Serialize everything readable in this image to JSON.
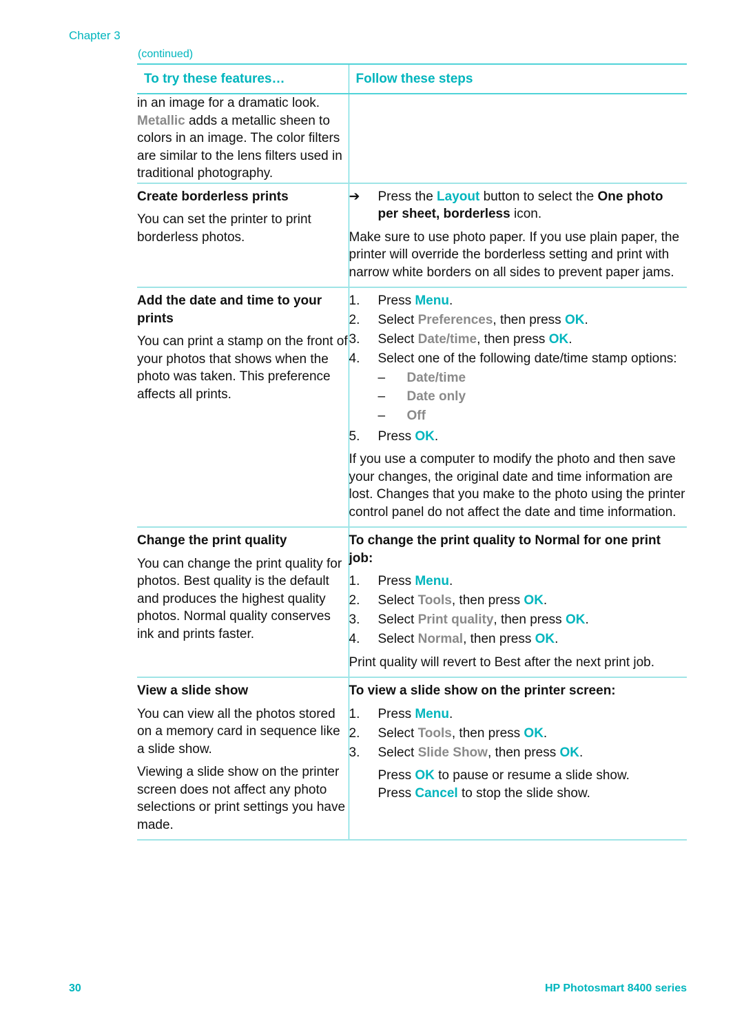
{
  "header": {
    "chapter": "Chapter 3",
    "continued": "(continued)"
  },
  "table": {
    "col1_header": "To try these features…",
    "col2_header": "Follow these steps",
    "rows": {
      "filters": {
        "left_text_1": "in an image for a dramatic look. ",
        "left_metallic": "Metallic",
        "left_text_2": " adds a metallic sheen to colors in an image. The color filters are similar to the lens filters used in traditional photography."
      },
      "borderless": {
        "title": "Create borderless prints",
        "desc": "You can set the printer to print borderless photos.",
        "arrow": "➔",
        "step_pre": "Press the ",
        "step_layout": "Layout",
        "step_mid": " button to select the ",
        "step_bold": "One photo per sheet, borderless",
        "step_post": " icon.",
        "note": "Make sure to use photo paper. If you use plain paper, the printer will override the borderless setting and print with narrow white borders on all sides to prevent paper jams."
      },
      "datetime": {
        "title": "Add the date and time to your prints",
        "desc": "You can print a stamp on the front of your photos that shows when the photo was taken. This preference affects all prints.",
        "steps": [
          {
            "num": "1.",
            "pre": "Press ",
            "hl": "Menu",
            "post": "."
          },
          {
            "num": "2.",
            "pre": "Select ",
            "gray": "Preferences",
            "mid": ", then press ",
            "hl": "OK",
            "post": "."
          },
          {
            "num": "3.",
            "pre": "Select ",
            "gray": "Date/time",
            "mid": ", then press ",
            "hl": "OK",
            "post": "."
          },
          {
            "num": "4.",
            "text": "Select one of the following date/time stamp options:"
          },
          {
            "num": "5.",
            "pre": "Press ",
            "hl": "OK",
            "post": "."
          }
        ],
        "options": [
          {
            "dash": "–",
            "label": "Date/time"
          },
          {
            "dash": "–",
            "label": "Date only"
          },
          {
            "dash": "–",
            "label": "Off"
          }
        ],
        "note": "If you use a computer to modify the photo and then save your changes, the original date and time information are lost. Changes that you make to the photo using the printer control panel do not affect the date and time information."
      },
      "quality": {
        "title": "Change the print quality",
        "desc": "You can change the print quality for photos. Best quality is the default and produces the highest quality photos. Normal quality conserves ink and prints faster.",
        "heading": "To change the print quality to Normal for one print job:",
        "steps": [
          {
            "num": "1.",
            "pre": "Press ",
            "hl": "Menu",
            "post": "."
          },
          {
            "num": "2.",
            "pre": "Select ",
            "gray": "Tools",
            "mid": ", then press ",
            "hl": "OK",
            "post": "."
          },
          {
            "num": "3.",
            "pre": "Select ",
            "gray": "Print quality",
            "mid": ", then press ",
            "hl": "OK",
            "post": "."
          },
          {
            "num": "4.",
            "pre": "Select ",
            "gray": "Normal",
            "mid": ", then press ",
            "hl": "OK",
            "post": "."
          }
        ],
        "note": "Print quality will revert to Best after the next print job."
      },
      "slideshow": {
        "title": "View a slide show",
        "desc_1": "You can view all the photos stored on a memory card in sequence like a slide show.",
        "desc_2": "Viewing a slide show on the printer screen does not affect any photo selections or print settings you have made.",
        "heading": "To view a slide show on the printer screen:",
        "steps": [
          {
            "num": "1.",
            "pre": "Press ",
            "hl": "Menu",
            "post": "."
          },
          {
            "num": "2.",
            "pre": "Select ",
            "gray": "Tools",
            "mid": ", then press ",
            "hl": "OK",
            "post": "."
          },
          {
            "num": "3.",
            "pre": "Select ",
            "gray": "Slide Show",
            "mid": ", then press ",
            "hl": "OK",
            "post": "."
          }
        ],
        "extra_1_pre": "Press ",
        "extra_1_hl": "OK",
        "extra_1_post": " to pause or resume a slide show.",
        "extra_2_pre": "Press ",
        "extra_2_hl": "Cancel",
        "extra_2_post": " to stop the slide show."
      }
    }
  },
  "footer": {
    "page_number": "30",
    "product": "HP Photosmart 8400 series"
  },
  "colors": {
    "accent": "#00b5bd",
    "ui_term_gray": "#8a8a8a",
    "rule": "#4fd3d8"
  }
}
